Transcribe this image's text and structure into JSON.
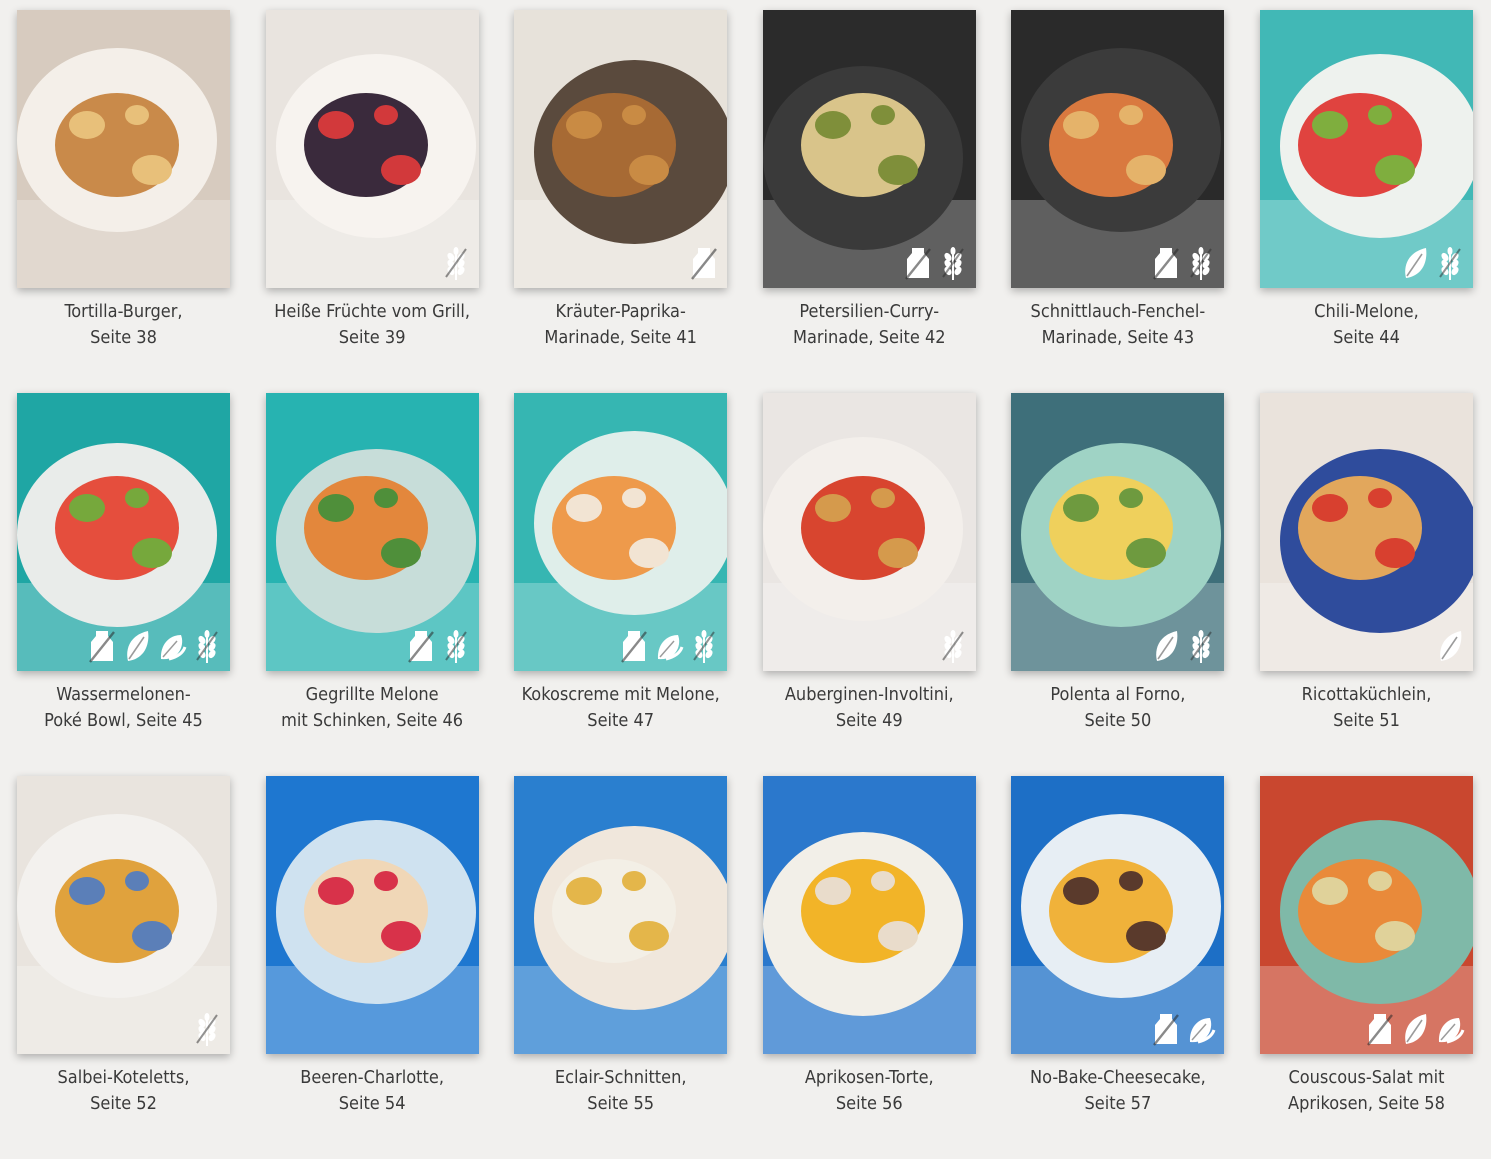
{
  "recipes": [
    {
      "line1": "Tortilla-Burger,",
      "line2": "Seite 38",
      "bg": "#d7cbbf",
      "plate": "#f4efe9",
      "food": "#c98a4a",
      "accent": "#e8c07a",
      "icons": []
    },
    {
      "line1": "Heiße Früchte vom Grill,",
      "line2": "Seite 39",
      "bg": "#e9e4df",
      "plate": "#f7f3ef",
      "food": "#3a2a3c",
      "accent": "#d2393b",
      "icons": [
        "grain-icon"
      ]
    },
    {
      "line1": "Kräuter-Paprika-",
      "line2": "Marinade, Seite 41",
      "bg": "#e7e2da",
      "plate": "#5a4a3d",
      "food": "#a76a34",
      "accent": "#c98b44",
      "icons": [
        "milk-icon"
      ]
    },
    {
      "line1": "Petersilien-Curry-",
      "line2": "Marinade, Seite 42",
      "bg": "#2b2b2b",
      "plate": "#3a3a3a",
      "food": "#d9c48a",
      "accent": "#7f8f3a",
      "icons": [
        "milk-icon",
        "grain-icon"
      ]
    },
    {
      "line1": "Schnittlauch-Fenchel-",
      "line2": "Marinade, Seite 43",
      "bg": "#2a2a2a",
      "plate": "#3b3b3b",
      "food": "#d9793f",
      "accent": "#e5b36a",
      "icons": [
        "milk-icon",
        "grain-icon"
      ]
    },
    {
      "line1": "Chili-Melone,",
      "line2": "Seite 44",
      "bg": "#41b8b6",
      "plate": "#eef2ee",
      "food": "#e0433f",
      "accent": "#7fae3e",
      "icons": [
        "leaf-icon",
        "grain-icon"
      ]
    },
    {
      "line1": "Wassermelonen-",
      "line2": "Poké Bowl, Seite 45",
      "bg": "#1fa6a4",
      "plate": "#e9ecea",
      "food": "#e54e3d",
      "accent": "#76a83c",
      "icons": [
        "milk-icon",
        "leaf-icon",
        "vegan-icon",
        "grain-icon"
      ]
    },
    {
      "line1": "Gegrillte Melone",
      "line2": "mit Schinken, Seite 46",
      "bg": "#27b3b1",
      "plate": "#c7ddd9",
      "food": "#e3873c",
      "accent": "#4f8f3a",
      "icons": [
        "milk-icon",
        "grain-icon"
      ]
    },
    {
      "line1": "Kokoscreme mit Melone,",
      "line2": "Seite 47",
      "bg": "#36b6b2",
      "plate": "#dfeeea",
      "food": "#ee9a4b",
      "accent": "#f2e4d3",
      "icons": [
        "milk-icon",
        "vegan-icon",
        "grain-icon"
      ]
    },
    {
      "line1": "Auberginen-Involtini,",
      "line2": "Seite 49",
      "bg": "#eae6e3",
      "plate": "#f3efeb",
      "food": "#d8452f",
      "accent": "#d59a4c",
      "icons": [
        "grain-icon"
      ]
    },
    {
      "line1": "Polenta al Forno,",
      "line2": "Seite 50",
      "bg": "#3e6f7a",
      "plate": "#9fd3c5",
      "food": "#efd05c",
      "accent": "#6e9a3f",
      "icons": [
        "leaf-icon",
        "grain-icon"
      ]
    },
    {
      "line1": "Ricottaküchlein,",
      "line2": "Seite 51",
      "bg": "#eae3dc",
      "plate": "#2f4c9c",
      "food": "#e2a75c",
      "accent": "#d8402f",
      "icons": [
        "leaf-icon"
      ]
    },
    {
      "line1": "Salbei-Koteletts,",
      "line2": "Seite 52",
      "bg": "#e9e4de",
      "plate": "#f3f1ee",
      "food": "#e0a23d",
      "accent": "#5b7fb8",
      "icons": [
        "grain-icon"
      ]
    },
    {
      "line1": "Beeren-Charlotte,",
      "line2": "Seite 54",
      "bg": "#1e77d0",
      "plate": "#cfe2f0",
      "food": "#f0d7b7",
      "accent": "#d8324a",
      "icons": []
    },
    {
      "line1": "Eclair-Schnitten,",
      "line2": "Seite 55",
      "bg": "#2a7fcf",
      "plate": "#f0e7dc",
      "food": "#f3efe6",
      "accent": "#e4b64a",
      "icons": []
    },
    {
      "line1": "Aprikosen-Torte,",
      "line2": "Seite 56",
      "bg": "#2b78cc",
      "plate": "#f2efe8",
      "food": "#f2b428",
      "accent": "#e9dccb",
      "icons": []
    },
    {
      "line1": "No-Bake-Cheesecake,",
      "line2": "Seite 57",
      "bg": "#1d6fc6",
      "plate": "#e7eef4",
      "food": "#f0b23a",
      "accent": "#5a3a2c",
      "icons": [
        "milk-icon",
        "vegan-icon"
      ]
    },
    {
      "line1": "Couscous-Salat mit",
      "line2": "Aprikosen, Seite 58",
      "bg": "#c9472f",
      "plate": "#7fb9a8",
      "food": "#e98a3a",
      "accent": "#e0d29a",
      "icons": [
        "milk-icon",
        "leaf-icon",
        "vegan-icon"
      ]
    }
  ]
}
